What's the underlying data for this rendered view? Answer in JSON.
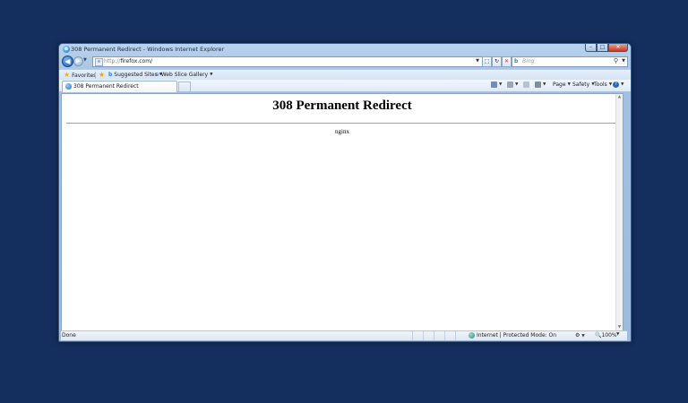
{
  "window": {
    "title": "308 Permanent Redirect - Windows Internet Explorer",
    "controls": {
      "minimize": "–",
      "maximize": "□",
      "close": "✕"
    }
  },
  "nav": {
    "address_protocol": "http://",
    "address_host": "firefox.com/",
    "search_placeholder": "Bing",
    "back_glyph": "◀",
    "forward_glyph": "▶"
  },
  "favorites_bar": {
    "favorites_label": "Favorites",
    "suggested_sites_label": "Suggested Sites",
    "web_slice_label": "Web Slice Gallery"
  },
  "tabs": [
    {
      "label": "308 Permanent Redirect"
    }
  ],
  "command_bar": {
    "page_label": "Page",
    "safety_label": "Safety",
    "tools_label": "Tools",
    "help_glyph": "?"
  },
  "page": {
    "heading": "308 Permanent Redirect",
    "server": "nginx"
  },
  "status_bar": {
    "status": "Done",
    "zone": "Internet | Protected Mode: On",
    "zoom": "100%"
  },
  "colors": {
    "desktop": "#142f5e",
    "window_frame": "#a3c1e2",
    "close_button": "#c53a22"
  }
}
